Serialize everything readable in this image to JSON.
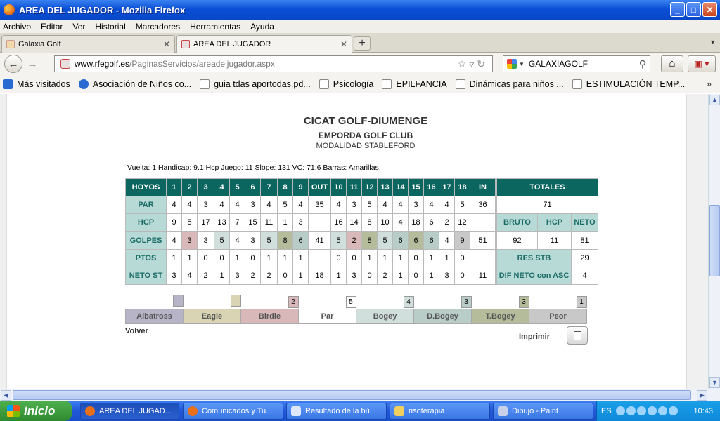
{
  "window": {
    "title": "AREA DEL JUGADOR - Mozilla Firefox",
    "min": "_",
    "max": "□",
    "close": "✕"
  },
  "menu": [
    "Archivo",
    "Editar",
    "Ver",
    "Historial",
    "Marcadores",
    "Herramientas",
    "Ayuda"
  ],
  "tabs": [
    {
      "label": "Galaxia Golf",
      "active": false
    },
    {
      "label": "AREA DEL JUGADOR",
      "active": true
    }
  ],
  "nav": {
    "url_domain": "www.rfegolf.es",
    "url_path": "/PaginasServicios/areadeljugador.aspx",
    "search_value": "GALAXIAGOLF"
  },
  "bookmarks": [
    "Más visitados",
    "Asociación de Niños co...",
    "guia tdas aportodas.pd...",
    "Psicología",
    "EPILFANCIA",
    "Dinámicas para niños ...",
    "ESTIMULACIÓN TEMP..."
  ],
  "scorecard": {
    "title": "CICAT GOLF-DIUMENGE",
    "club": "EMPORDA GOLF CLUB",
    "mode": "MODALIDAD STABLEFORD",
    "info": "Vuelta: 1 Handicap: 9.1   Hcp Juego: 11   Slope: 131   VC: 71.6   Barras: Amarillas",
    "header": [
      "HOYOS",
      "1",
      "2",
      "3",
      "4",
      "5",
      "6",
      "7",
      "8",
      "9",
      "OUT",
      "10",
      "11",
      "12",
      "13",
      "14",
      "15",
      "16",
      "17",
      "18",
      "IN"
    ],
    "totales_label": "TOTALES",
    "par": {
      "label": "PAR",
      "values": [
        "4",
        "4",
        "3",
        "4",
        "4",
        "3",
        "4",
        "5",
        "4",
        "35",
        "4",
        "3",
        "5",
        "4",
        "4",
        "3",
        "4",
        "4",
        "5",
        "36"
      ],
      "total": "71"
    },
    "hcp": {
      "label": "HCP",
      "values": [
        "9",
        "5",
        "17",
        "13",
        "7",
        "15",
        "11",
        "1",
        "3",
        "",
        "16",
        "14",
        "8",
        "10",
        "4",
        "18",
        "6",
        "2",
        "12",
        ""
      ]
    },
    "totals_header": [
      "BRUTO",
      "HCP",
      "NETO"
    ],
    "golpes": {
      "label": "GOLPES",
      "values": [
        "4",
        "3",
        "3",
        "5",
        "4",
        "3",
        "5",
        "8",
        "6",
        "41",
        "5",
        "2",
        "8",
        "5",
        "6",
        "6",
        "6",
        "4",
        "9",
        "51"
      ],
      "bruto": "92",
      "hcp": "11",
      "neto": "81"
    },
    "ptos": {
      "label": "PTOS",
      "values": [
        "1",
        "1",
        "0",
        "0",
        "1",
        "0",
        "1",
        "1",
        "1",
        "",
        "0",
        "0",
        "1",
        "1",
        "1",
        "0",
        "1",
        "1",
        "0",
        ""
      ],
      "res_label": "RES STB",
      "res_value": "29"
    },
    "netost": {
      "label": "NETO ST",
      "values": [
        "3",
        "4",
        "2",
        "1",
        "3",
        "2",
        "2",
        "0",
        "1",
        "18",
        "1",
        "3",
        "0",
        "2",
        "1",
        "0",
        "1",
        "3",
        "0",
        "11"
      ],
      "dif_label": "DIF NETO con ASC",
      "dif_value": "4"
    }
  },
  "legend": [
    {
      "label": "Albatross",
      "count": "",
      "color": "#b8b4c8"
    },
    {
      "label": "Eagle",
      "count": "",
      "color": "#d8d4b4"
    },
    {
      "label": "Birdie",
      "count": "2",
      "color": "#d8b8b8"
    },
    {
      "label": "Par",
      "count": "5",
      "color": "#ffffff"
    },
    {
      "label": "Bogey",
      "count": "4",
      "color": "#d0dedc"
    },
    {
      "label": "D.Bogey",
      "count": "3",
      "color": "#b8ccc8"
    },
    {
      "label": "T.Bogey",
      "count": "3",
      "color": "#b4bc9c"
    },
    {
      "label": "Peor",
      "count": "1",
      "color": "#c8c8c8"
    }
  ],
  "links": {
    "volver": "Volver",
    "imprimir": "Imprimir"
  },
  "taskbar": {
    "start": "Inicio",
    "tasks": [
      "AREA DEL JUGAD...",
      "Comunicados y Tu...",
      "Resultado de la bú...",
      "risoterapia",
      "Dibujo - Paint"
    ],
    "lang": "ES",
    "clock": "10:43"
  }
}
